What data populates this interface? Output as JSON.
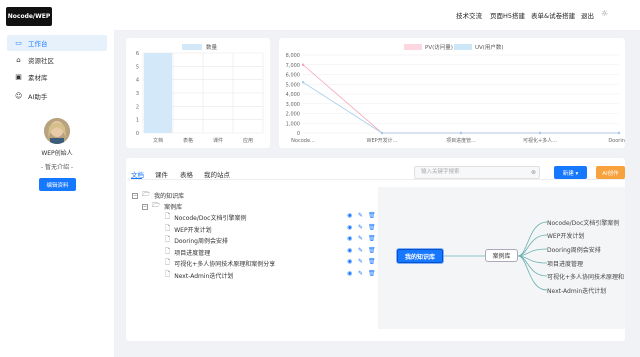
{
  "app": {
    "logo_text": "Nocode/WEP"
  },
  "topnav": {
    "items": [
      "技术交流",
      "页面H5搭建",
      "表单&试卷搭建",
      "退出"
    ]
  },
  "sidebar": {
    "items": [
      {
        "label": "工作台",
        "icon": "monitor-icon"
      },
      {
        "label": "资源社区",
        "icon": "community-icon"
      },
      {
        "label": "素材库",
        "icon": "library-icon"
      },
      {
        "label": "AI助手",
        "icon": "robot-icon"
      }
    ],
    "profile": {
      "name": "WEP创始人",
      "desc": "- 暂无介绍 -",
      "edit_label": "编辑资料"
    }
  },
  "bar_chart": {
    "legend": "数量",
    "color": "#d3e8f8",
    "chart_data": {
      "type": "bar",
      "categories": [
        "文档",
        "表格",
        "课件",
        "应用"
      ],
      "values": [
        6,
        0,
        0,
        0
      ],
      "ylim": [
        0,
        6
      ],
      "yticks": [
        "0",
        "1",
        "2",
        "3",
        "4",
        "5",
        "6"
      ]
    }
  },
  "line_chart": {
    "legend": [
      {
        "name": "PV(访问量)",
        "color": "#fcd7df"
      },
      {
        "name": "UV(用户数)",
        "color": "#cde6f8"
      }
    ],
    "chart_data": {
      "type": "line",
      "categories": [
        "Nocode...",
        "WEP开发计...",
        "项目进度管...",
        "可视化+多人...",
        "Doorin..."
      ],
      "series": [
        {
          "name": "PV(访问量)",
          "values": [
            7000,
            0,
            0,
            0,
            0
          ],
          "color": "#f6a2b4"
        },
        {
          "name": "UV(用户数)",
          "values": [
            5200,
            0,
            0,
            0,
            0
          ],
          "color": "#9fcbef"
        }
      ],
      "ylim": [
        0,
        8000
      ],
      "yticks": [
        "0",
        "1,000",
        "2,000",
        "3,000",
        "4,000",
        "5,000",
        "6,000",
        "7,000",
        "8,000"
      ]
    }
  },
  "tabs": [
    "文档",
    "课件",
    "表格",
    "我的站点"
  ],
  "search": {
    "placeholder": "输入关键字搜索"
  },
  "buttons": {
    "new_label": "新建 ▾",
    "ai_label": "AI创作"
  },
  "tree": {
    "root": "我的知识库",
    "folder": "案例库",
    "docs": [
      "Nocode/Doc文档引擎案例",
      "WEP开发计划",
      "Dooring周例会安排",
      "项目进度管理",
      "可视化+多人协同技术原理和案例分享",
      "Next-Admin迭代计划"
    ]
  },
  "mindmap": {
    "root": "我的知识库",
    "mid": "案例库",
    "leaves": [
      "Nocode/Doc文档引擎案例",
      "WEP开发计划",
      "Dooring周例会安排",
      "项目进度管理",
      "可视化+多人协同技术原理和",
      "Next-Admin迭代计划"
    ]
  }
}
